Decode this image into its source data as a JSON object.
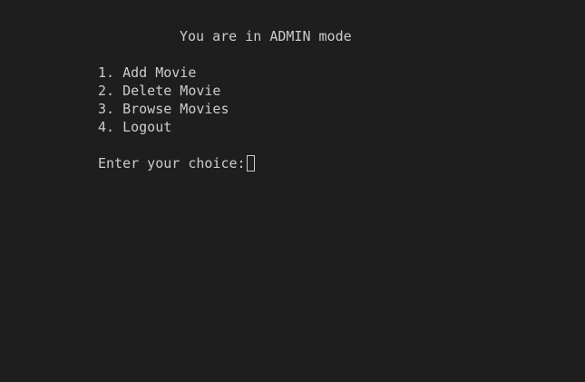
{
  "terminal": {
    "header": "You are in ADMIN mode",
    "menu": [
      {
        "label": "1. Add Movie"
      },
      {
        "label": "2. Delete Movie"
      },
      {
        "label": "3. Browse Movies"
      },
      {
        "label": "4. Logout"
      }
    ],
    "prompt": "Enter your choice:",
    "colors": {
      "background": "#1e1e1e",
      "text": "#cccccc"
    }
  }
}
